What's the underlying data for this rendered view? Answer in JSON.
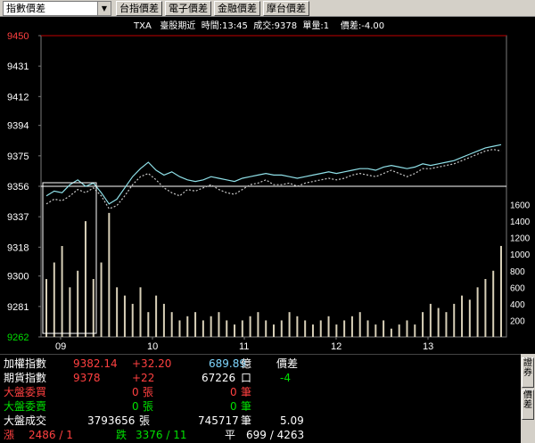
{
  "toolbar": {
    "select_value": "指數價差",
    "buttons": [
      "台指價差",
      "電子價差",
      "金融價差",
      "摩台價差"
    ]
  },
  "info_line": "TXA   臺股期近  時間:13:45  成交:9378  單量:1    價差:-4.00",
  "chart_data": {
    "type": "line",
    "y_ticks": [
      "9450",
      "9431",
      "9412",
      "9394",
      "9375",
      "9356",
      "9337",
      "9318",
      "9300",
      "9281",
      "9262"
    ],
    "ylim": [
      9262,
      9450
    ],
    "volume_ticks": [
      "1600",
      "1400",
      "1200",
      "1000",
      "800",
      "600",
      "400",
      "200"
    ],
    "volume_ylim": [
      0,
      1800
    ],
    "x_ticks": [
      "09",
      "10",
      "11",
      "12",
      "13"
    ],
    "reference_price": 9356,
    "series": [
      {
        "values": [
          9350,
          9353,
          9352,
          9357,
          9360,
          9356,
          9358,
          9352,
          9345,
          9348,
          9355,
          9362,
          9367,
          9371,
          9366,
          9363,
          9365,
          9362,
          9360,
          9359,
          9360,
          9362,
          9361,
          9360,
          9359,
          9361,
          9362,
          9363,
          9364,
          9363,
          9363,
          9362,
          9361,
          9362,
          9363,
          9364,
          9365,
          9364,
          9365,
          9366,
          9367,
          9367,
          9366,
          9368,
          9369,
          9368,
          9367,
          9368,
          9370,
          9369,
          9370,
          9371,
          9372,
          9374,
          9376,
          9378,
          9380,
          9381,
          9382
        ]
      },
      {
        "values": [
          9345,
          9348,
          9347,
          9350,
          9354,
          9352,
          9355,
          9350,
          9342,
          9344,
          9350,
          9357,
          9362,
          9364,
          9360,
          9355,
          9352,
          9350,
          9354,
          9353,
          9355,
          9357,
          9354,
          9352,
          9351,
          9354,
          9357,
          9358,
          9360,
          9357,
          9357,
          9358,
          9356,
          9358,
          9359,
          9360,
          9361,
          9360,
          9361,
          9363,
          9364,
          9363,
          9362,
          9364,
          9366,
          9364,
          9362,
          9364,
          9367,
          9367,
          9368,
          9369,
          9370,
          9372,
          9374,
          9376,
          9378,
          9379,
          9378
        ]
      }
    ],
    "volume": [
      700,
      900,
      1100,
      600,
      800,
      1400,
      700,
      900,
      1500,
      600,
      500,
      400,
      600,
      300,
      500,
      400,
      300,
      200,
      250,
      300,
      200,
      250,
      300,
      200,
      150,
      200,
      250,
      300,
      200,
      150,
      200,
      300,
      250,
      200,
      150,
      200,
      250,
      150,
      200,
      250,
      300,
      200,
      150,
      200,
      100,
      150,
      200,
      150,
      300,
      400,
      350,
      300,
      400,
      500,
      450,
      600,
      700,
      800,
      1100
    ]
  },
  "quote": {
    "rows": [
      {
        "label": "加權指數",
        "v1": "9382.14",
        "v2": "+32.20",
        "v3": "689.89",
        "v4": "億",
        "v5": "價差"
      },
      {
        "label": "期貨指數",
        "v1": "9378",
        "v2": "+22",
        "v3": "67226",
        "v4": "口",
        "v5": "-4"
      },
      {
        "label": "大盤委買",
        "v2": "0",
        "v2u": "張",
        "v3": "0",
        "v4": "筆"
      },
      {
        "label": "大盤委賣",
        "v2": "0",
        "v2u": "張",
        "v3": "0",
        "v4": "筆"
      },
      {
        "label": "大盤成交",
        "v2": "3793656",
        "v2u": "張",
        "v3": "745717",
        "v4": "筆",
        "v5": "5.09"
      }
    ],
    "last": {
      "up_label": "漲",
      "up": "2486 / 1",
      "down_label": "跌",
      "down": "3376 / 11",
      "flat_label": "平",
      "flat": "699 / 4263"
    }
  },
  "side_tabs": [
    "證券",
    "價差"
  ]
}
